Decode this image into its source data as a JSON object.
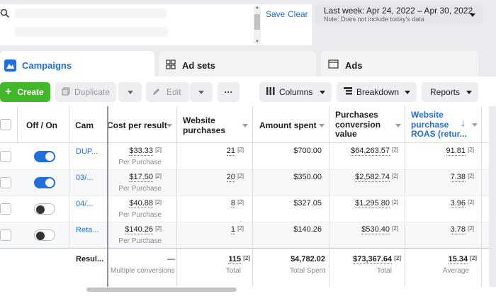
{
  "search": {
    "save_label": "Save",
    "clear_label": "Clear"
  },
  "date_range": {
    "label": "Last week: Apr 24, 2022 – Apr 30, 2022",
    "note": "Note: Does not include today's data"
  },
  "tabs": [
    {
      "label": "Campaigns",
      "active": true
    },
    {
      "label": "Ad sets",
      "active": false
    },
    {
      "label": "Ads",
      "active": false
    }
  ],
  "toolbar": {
    "create_label": "Create",
    "duplicate_label": "Duplicate",
    "edit_label": "Edit",
    "more_label": "···",
    "columns_label": "Columns",
    "breakdown_label": "Breakdown",
    "reports_label": "Reports"
  },
  "columns": {
    "onoff": "Off / On",
    "campaign": "Cam",
    "cost": "Cost per result",
    "purchases": "Website purchases",
    "spent": "Amount spent",
    "conv_value": "Purchases conversion value",
    "roas": "Website purchase ROAS (retur..."
  },
  "rows": [
    {
      "name": "DUP...",
      "on": true,
      "cost": "$33.33",
      "cost_sub": "Per Purchase",
      "purchases": "21",
      "spent": "$700.00",
      "conv": "$64,263.57",
      "roas": "91.81"
    },
    {
      "name": "03/...",
      "on": true,
      "cost": "$17.50",
      "cost_sub": "Per Purchase",
      "purchases": "20",
      "spent": "$350.00",
      "conv": "$2,582.74",
      "roas": "7.38"
    },
    {
      "name": "04/...",
      "on": false,
      "cost": "$40.88",
      "cost_sub": "Per Purchase",
      "purchases": "8",
      "spent": "$327.05",
      "conv": "$1,295.80",
      "roas": "3.96"
    },
    {
      "name": "Reta...",
      "on": false,
      "cost": "$140.26",
      "cost_sub": "Per Purchase",
      "purchases": "1",
      "spent": "$140.26",
      "conv": "$530.40",
      "roas": "3.78"
    }
  ],
  "note_marker": "[2]",
  "totals": {
    "label": "Resul...",
    "cost": "—",
    "cost_sub": "Multiple conversions",
    "purchases": "115",
    "purchases_sub": "Total",
    "spent": "$4,782.02",
    "spent_sub": "Total Spent",
    "conv": "$73,367.64",
    "conv_sub": "Total",
    "roas": "15.34",
    "roas_sub": "Average"
  },
  "colors": {
    "accent": "#216fdb",
    "create": "#42b72a"
  }
}
